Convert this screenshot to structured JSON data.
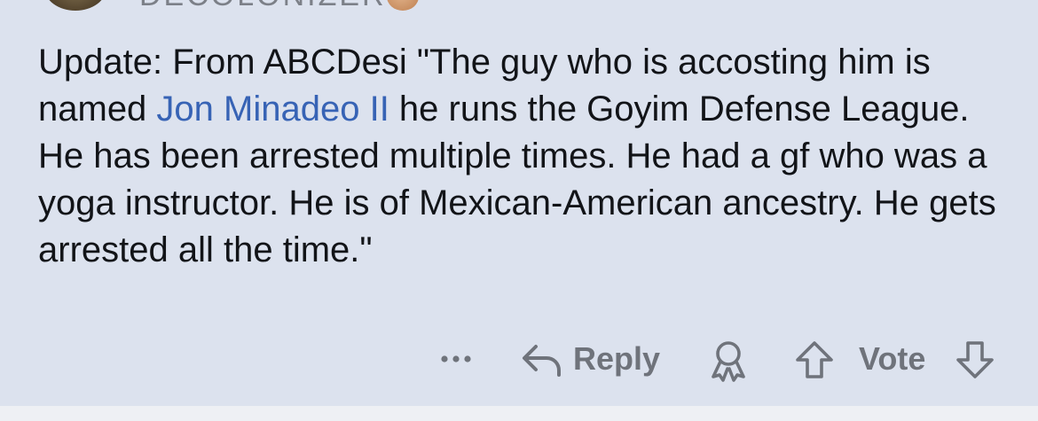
{
  "comment": {
    "username": "DECOLONIZER",
    "body": {
      "text_before_link": "Update: From ABCDesi  \"The guy who is accosting him is named ",
      "link_text": "Jon Minadeo II",
      "text_after_link": " he runs the Goyim Defense League. He has been arrested multiple times. He had a gf who was a yoga instructor. He is of Mexican-American ancestry. He gets arrested all the time.\""
    },
    "actions": {
      "more_icon": "more-dots-icon",
      "reply_icon": "reply-arrow-icon",
      "reply_label": "Reply",
      "award_icon": "award-icon",
      "upvote_icon": "upvote-arrow-icon",
      "vote_label": "Vote",
      "downvote_icon": "downvote-arrow-icon"
    }
  },
  "colors": {
    "background": "#dce2ee",
    "text": "#121418",
    "link": "#3763b5",
    "action": "#6f737b"
  }
}
